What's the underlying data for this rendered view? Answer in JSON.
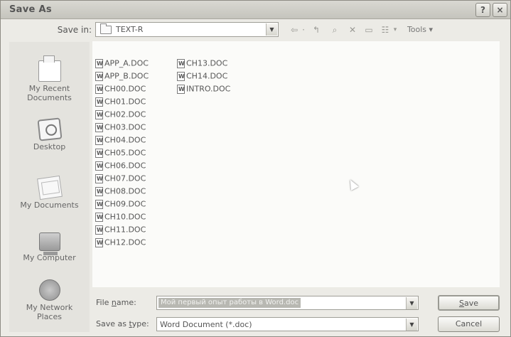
{
  "window": {
    "title": "Save As"
  },
  "title_buttons": {
    "help": "?",
    "close": "×"
  },
  "save_in": {
    "label": "Save in:",
    "value": "TEXT-R"
  },
  "toolbar": {
    "back": "⇦",
    "separator": "·",
    "up_folder": "↰",
    "search": "⌕",
    "delete": "✕",
    "new_folder": "▭",
    "views": "☷",
    "views_arrow": "▾",
    "tools_label": "Tools ▾"
  },
  "places": [
    {
      "label_line1": "My Recent",
      "label_line2": "Documents",
      "icon": "recent-documents-icon"
    },
    {
      "label_line1": "Desktop",
      "label_line2": "",
      "icon": "desktop-icon"
    },
    {
      "label_line1": "My Documents",
      "label_line2": "",
      "icon": "my-documents-icon"
    },
    {
      "label_line1": "My Computer",
      "label_line2": "",
      "icon": "my-computer-icon"
    },
    {
      "label_line1": "My Network",
      "label_line2": "Places",
      "icon": "network-places-icon"
    }
  ],
  "files": {
    "column1": [
      "APP_A.DOC",
      "APP_B.DOC",
      "CH00.DOC",
      "CH01.DOC",
      "CH02.DOC",
      "CH03.DOC",
      "CH04.DOC",
      "CH05.DOC",
      "CH06.DOC",
      "CH07.DOC",
      "CH08.DOC",
      "CH09.DOC",
      "CH10.DOC",
      "CH11.DOC",
      "CH12.DOC"
    ],
    "column2": [
      "CH13.DOC",
      "CH14.DOC",
      "INTRO.DOC"
    ]
  },
  "file_name": {
    "label_prefix": "File ",
    "label_underlined": "n",
    "label_suffix": "ame:",
    "value": "Мой первый опыт работы в Word.doc"
  },
  "save_as_type": {
    "label_prefix": "Save as ",
    "label_underlined": "t",
    "label_suffix": "ype:",
    "value": "Word Document (*.doc)"
  },
  "buttons": {
    "save_prefix": "",
    "save_underlined": "S",
    "save_suffix": "ave",
    "cancel": "Cancel"
  },
  "combo_arrow": "▼"
}
